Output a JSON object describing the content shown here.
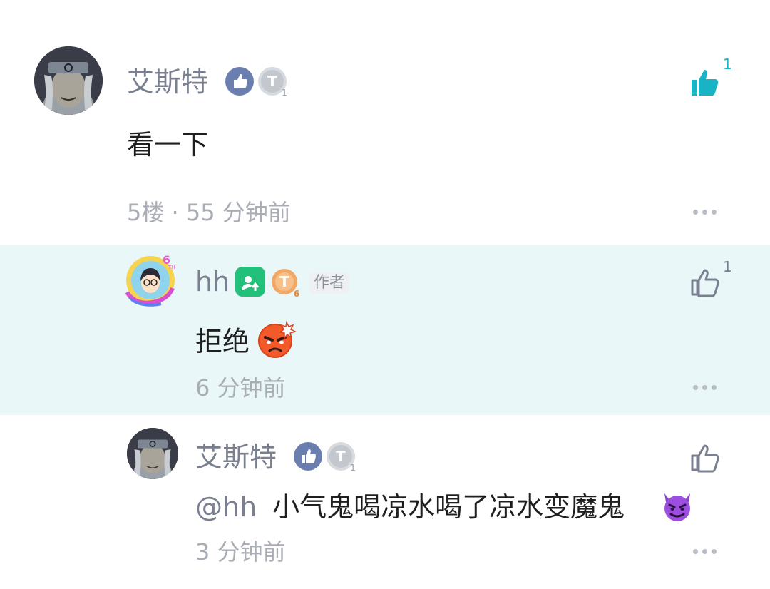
{
  "comments": [
    {
      "username": "艾斯特",
      "content": "看一下",
      "floor": "5楼",
      "meta_sep": " · ",
      "time": "55 分钟前",
      "likes": "1",
      "liked": true
    },
    {
      "username": "hh",
      "author_tag": "作者",
      "content": "拒绝",
      "time": "6 分钟前",
      "likes": "1",
      "liked": false
    },
    {
      "username": "艾斯特",
      "mention": "@hh",
      "content": "小气鬼喝凉水喝了凉水变魔鬼",
      "time": "3 分钟前",
      "likes": "",
      "liked": false
    }
  ],
  "colors": {
    "like_active": "#19b3c6",
    "like_inactive": "#7a8090",
    "highlight_bg": "#eaf7f8",
    "badge_blue": "#6a7fb0",
    "badge_green": "#22c07a",
    "badge_orange": "#f0a55a"
  },
  "icons": {
    "like": "thumbs-up-icon",
    "more": "more-dots-icon",
    "angry_emoji": "angry-face-emoji",
    "devil_emoji": "smiling-devil-emoji"
  }
}
